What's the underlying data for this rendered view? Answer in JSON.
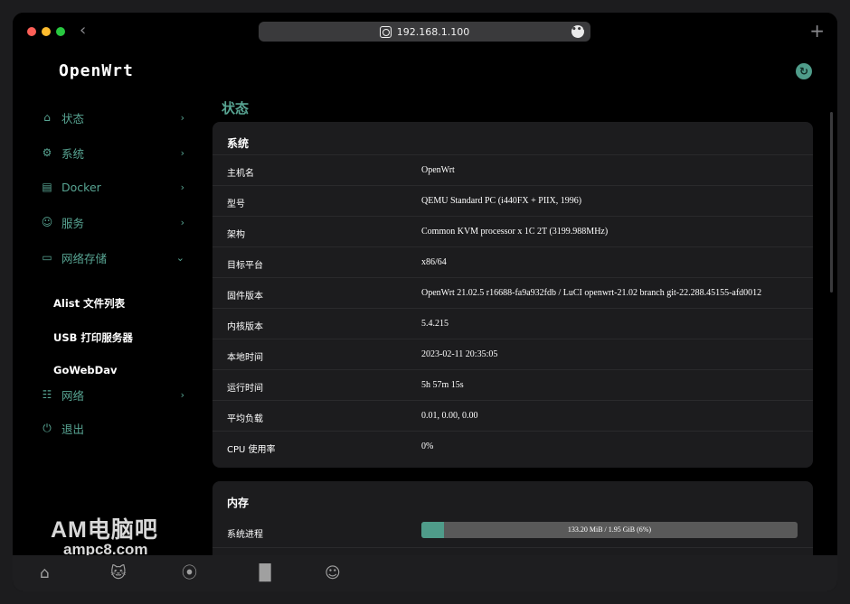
{
  "browser": {
    "url": "192.168.1.100"
  },
  "brand": "OpenWrt",
  "sidebar": {
    "items": [
      {
        "label": "状态",
        "icon": "home-icon"
      },
      {
        "label": "系统",
        "icon": "gear-icon"
      },
      {
        "label": "Docker",
        "icon": "docker-icon"
      },
      {
        "label": "服务",
        "icon": "user-service-icon"
      },
      {
        "label": "网络存储",
        "icon": "storage-icon"
      },
      {
        "label": "网络",
        "icon": "network-icon"
      },
      {
        "label": "退出",
        "icon": "power-icon"
      }
    ],
    "sub_items": [
      "Alist 文件列表",
      "USB 打印服务器",
      "GoWebDav"
    ]
  },
  "page_title": "状态",
  "system": {
    "title": "系统",
    "rows": [
      {
        "key": "主机名",
        "value": "OpenWrt"
      },
      {
        "key": "型号",
        "value": "QEMU Standard PC (i440FX + PIIX, 1996)"
      },
      {
        "key": "架构",
        "value": "Common KVM processor x 1C 2T (3199.988MHz)"
      },
      {
        "key": "目标平台",
        "value": "x86/64"
      },
      {
        "key": "固件版本",
        "value": "OpenWrt 21.02.5 r16688-fa9a932fdb / LuCI openwrt-21.02 branch git-22.288.45155-afd0012"
      },
      {
        "key": "内核版本",
        "value": "5.4.215"
      },
      {
        "key": "本地时间",
        "value": "2023-02-11 20:35:05"
      },
      {
        "key": "运行时间",
        "value": "5h 57m 15s"
      },
      {
        "key": "平均负载",
        "value": "0.01, 0.00, 0.00"
      },
      {
        "key": "CPU 使用率",
        "value": "0%"
      }
    ]
  },
  "memory": {
    "title": "内存",
    "rows": [
      {
        "key": "系统进程",
        "value": "133.20 MiB / 1.95 GiB (6%)",
        "percent": 6
      }
    ]
  },
  "watermark": {
    "line1": "AM电脑吧",
    "line2": "ampc8.com"
  },
  "colors": {
    "accent": "#58a593",
    "background": "#000000",
    "card": "#1c1c1e"
  }
}
